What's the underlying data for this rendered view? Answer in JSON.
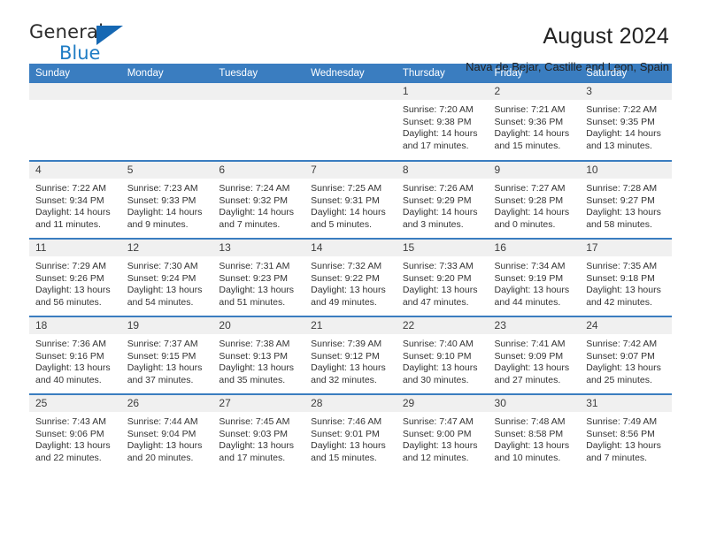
{
  "logo": {
    "word1": "General",
    "word2": "Blue",
    "triangle_color": "#1668b3",
    "word2_color": "#1f7cc4"
  },
  "header": {
    "title": "August 2024",
    "subtitle": "Nava de Bejar, Castille and Leon, Spain"
  },
  "theme": {
    "header_bg": "#3a7dc0",
    "header_text": "#ffffff",
    "daynum_bg": "#f0f0f0",
    "row_border": "#3a7dc0"
  },
  "weekdays": [
    "Sunday",
    "Monday",
    "Tuesday",
    "Wednesday",
    "Thursday",
    "Friday",
    "Saturday"
  ],
  "labels": {
    "sunrise": "Sunrise:",
    "sunset": "Sunset:",
    "daylight": "Daylight:"
  },
  "weeks": [
    [
      {
        "day": "",
        "empty": true
      },
      {
        "day": "",
        "empty": true
      },
      {
        "day": "",
        "empty": true
      },
      {
        "day": "",
        "empty": true
      },
      {
        "day": "1",
        "sunrise": "Sunrise: 7:20 AM",
        "sunset": "Sunset: 9:38 PM",
        "daylight1": "Daylight: 14 hours",
        "daylight2": "and 17 minutes."
      },
      {
        "day": "2",
        "sunrise": "Sunrise: 7:21 AM",
        "sunset": "Sunset: 9:36 PM",
        "daylight1": "Daylight: 14 hours",
        "daylight2": "and 15 minutes."
      },
      {
        "day": "3",
        "sunrise": "Sunrise: 7:22 AM",
        "sunset": "Sunset: 9:35 PM",
        "daylight1": "Daylight: 14 hours",
        "daylight2": "and 13 minutes."
      }
    ],
    [
      {
        "day": "4",
        "sunrise": "Sunrise: 7:22 AM",
        "sunset": "Sunset: 9:34 PM",
        "daylight1": "Daylight: 14 hours",
        "daylight2": "and 11 minutes."
      },
      {
        "day": "5",
        "sunrise": "Sunrise: 7:23 AM",
        "sunset": "Sunset: 9:33 PM",
        "daylight1": "Daylight: 14 hours",
        "daylight2": "and 9 minutes."
      },
      {
        "day": "6",
        "sunrise": "Sunrise: 7:24 AM",
        "sunset": "Sunset: 9:32 PM",
        "daylight1": "Daylight: 14 hours",
        "daylight2": "and 7 minutes."
      },
      {
        "day": "7",
        "sunrise": "Sunrise: 7:25 AM",
        "sunset": "Sunset: 9:31 PM",
        "daylight1": "Daylight: 14 hours",
        "daylight2": "and 5 minutes."
      },
      {
        "day": "8",
        "sunrise": "Sunrise: 7:26 AM",
        "sunset": "Sunset: 9:29 PM",
        "daylight1": "Daylight: 14 hours",
        "daylight2": "and 3 minutes."
      },
      {
        "day": "9",
        "sunrise": "Sunrise: 7:27 AM",
        "sunset": "Sunset: 9:28 PM",
        "daylight1": "Daylight: 14 hours",
        "daylight2": "and 0 minutes."
      },
      {
        "day": "10",
        "sunrise": "Sunrise: 7:28 AM",
        "sunset": "Sunset: 9:27 PM",
        "daylight1": "Daylight: 13 hours",
        "daylight2": "and 58 minutes."
      }
    ],
    [
      {
        "day": "11",
        "sunrise": "Sunrise: 7:29 AM",
        "sunset": "Sunset: 9:26 PM",
        "daylight1": "Daylight: 13 hours",
        "daylight2": "and 56 minutes."
      },
      {
        "day": "12",
        "sunrise": "Sunrise: 7:30 AM",
        "sunset": "Sunset: 9:24 PM",
        "daylight1": "Daylight: 13 hours",
        "daylight2": "and 54 minutes."
      },
      {
        "day": "13",
        "sunrise": "Sunrise: 7:31 AM",
        "sunset": "Sunset: 9:23 PM",
        "daylight1": "Daylight: 13 hours",
        "daylight2": "and 51 minutes."
      },
      {
        "day": "14",
        "sunrise": "Sunrise: 7:32 AM",
        "sunset": "Sunset: 9:22 PM",
        "daylight1": "Daylight: 13 hours",
        "daylight2": "and 49 minutes."
      },
      {
        "day": "15",
        "sunrise": "Sunrise: 7:33 AM",
        "sunset": "Sunset: 9:20 PM",
        "daylight1": "Daylight: 13 hours",
        "daylight2": "and 47 minutes."
      },
      {
        "day": "16",
        "sunrise": "Sunrise: 7:34 AM",
        "sunset": "Sunset: 9:19 PM",
        "daylight1": "Daylight: 13 hours",
        "daylight2": "and 44 minutes."
      },
      {
        "day": "17",
        "sunrise": "Sunrise: 7:35 AM",
        "sunset": "Sunset: 9:18 PM",
        "daylight1": "Daylight: 13 hours",
        "daylight2": "and 42 minutes."
      }
    ],
    [
      {
        "day": "18",
        "sunrise": "Sunrise: 7:36 AM",
        "sunset": "Sunset: 9:16 PM",
        "daylight1": "Daylight: 13 hours",
        "daylight2": "and 40 minutes."
      },
      {
        "day": "19",
        "sunrise": "Sunrise: 7:37 AM",
        "sunset": "Sunset: 9:15 PM",
        "daylight1": "Daylight: 13 hours",
        "daylight2": "and 37 minutes."
      },
      {
        "day": "20",
        "sunrise": "Sunrise: 7:38 AM",
        "sunset": "Sunset: 9:13 PM",
        "daylight1": "Daylight: 13 hours",
        "daylight2": "and 35 minutes."
      },
      {
        "day": "21",
        "sunrise": "Sunrise: 7:39 AM",
        "sunset": "Sunset: 9:12 PM",
        "daylight1": "Daylight: 13 hours",
        "daylight2": "and 32 minutes."
      },
      {
        "day": "22",
        "sunrise": "Sunrise: 7:40 AM",
        "sunset": "Sunset: 9:10 PM",
        "daylight1": "Daylight: 13 hours",
        "daylight2": "and 30 minutes."
      },
      {
        "day": "23",
        "sunrise": "Sunrise: 7:41 AM",
        "sunset": "Sunset: 9:09 PM",
        "daylight1": "Daylight: 13 hours",
        "daylight2": "and 27 minutes."
      },
      {
        "day": "24",
        "sunrise": "Sunrise: 7:42 AM",
        "sunset": "Sunset: 9:07 PM",
        "daylight1": "Daylight: 13 hours",
        "daylight2": "and 25 minutes."
      }
    ],
    [
      {
        "day": "25",
        "sunrise": "Sunrise: 7:43 AM",
        "sunset": "Sunset: 9:06 PM",
        "daylight1": "Daylight: 13 hours",
        "daylight2": "and 22 minutes."
      },
      {
        "day": "26",
        "sunrise": "Sunrise: 7:44 AM",
        "sunset": "Sunset: 9:04 PM",
        "daylight1": "Daylight: 13 hours",
        "daylight2": "and 20 minutes."
      },
      {
        "day": "27",
        "sunrise": "Sunrise: 7:45 AM",
        "sunset": "Sunset: 9:03 PM",
        "daylight1": "Daylight: 13 hours",
        "daylight2": "and 17 minutes."
      },
      {
        "day": "28",
        "sunrise": "Sunrise: 7:46 AM",
        "sunset": "Sunset: 9:01 PM",
        "daylight1": "Daylight: 13 hours",
        "daylight2": "and 15 minutes."
      },
      {
        "day": "29",
        "sunrise": "Sunrise: 7:47 AM",
        "sunset": "Sunset: 9:00 PM",
        "daylight1": "Daylight: 13 hours",
        "daylight2": "and 12 minutes."
      },
      {
        "day": "30",
        "sunrise": "Sunrise: 7:48 AM",
        "sunset": "Sunset: 8:58 PM",
        "daylight1": "Daylight: 13 hours",
        "daylight2": "and 10 minutes."
      },
      {
        "day": "31",
        "sunrise": "Sunrise: 7:49 AM",
        "sunset": "Sunset: 8:56 PM",
        "daylight1": "Daylight: 13 hours",
        "daylight2": "and 7 minutes."
      }
    ]
  ]
}
